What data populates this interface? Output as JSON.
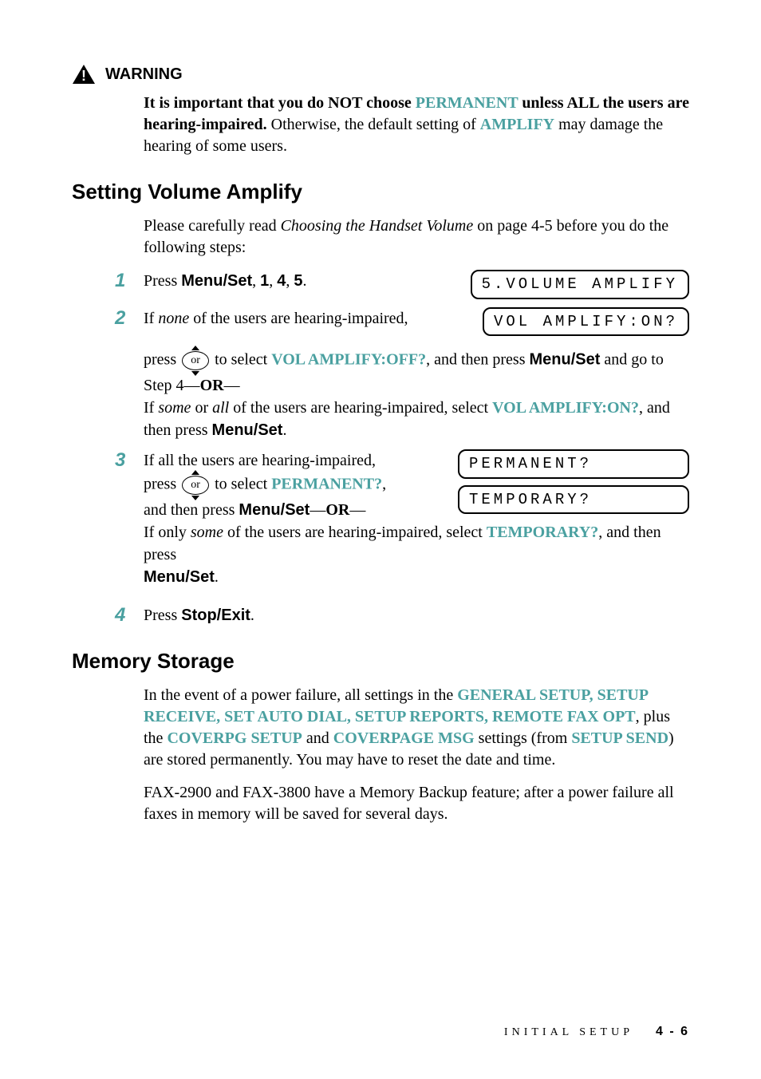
{
  "warning": {
    "label": "WARNING",
    "sentence_bold_lead": "It is important that you do NOT choose ",
    "permanent": "PERMANENT",
    "sentence_bold_tail": " unless ALL the users are hearing-impaired.",
    "sentence_rest_a": " Otherwise, the default setting of ",
    "amplify": "AMPLIFY",
    "sentence_rest_b": " may damage the hearing of some users."
  },
  "section1": {
    "title": "Setting Volume Amplify",
    "intro_a": "Please carefully read ",
    "intro_it": "Choosing the Handset Volume",
    "intro_b": " on page 4-5 before you do the following steps:"
  },
  "steps": {
    "s1": {
      "num": "1",
      "a": "Press ",
      "btn": "Menu/Set",
      "b": ", ",
      "k1": "1",
      "c": ", ",
      "k2": "4",
      "d": ", ",
      "k3": "5",
      "e": "."
    },
    "s2": {
      "num": "2",
      "line1_a": "If ",
      "line1_it": "none",
      "line1_b": " of the users are hearing-impaired,",
      "line2_a": " press ",
      "line2_b": " to select ",
      "teal1": "VOL AMPLIFY:OFF?",
      "line2_c": ", and then press ",
      "btn": "Menu/Set",
      "line2_d": " and go to Step 4—",
      "or": "OR",
      "line2_e": "—",
      "line3_a": "If ",
      "line3_it1": "some",
      "line3_b": " or ",
      "line3_it2": "all",
      "line3_c": " of the users are hearing-impaired, select ",
      "teal2": "VOL AMPLIFY:ON?",
      "line3_d": ", and then press ",
      "btn2": "Menu/Set",
      "line3_e": "."
    },
    "s3": {
      "num": "3",
      "l1": "If all the users are hearing-impaired,",
      "l2a": "press ",
      "l2b": " to select ",
      "teal1": "PERMANENT?",
      "l2c": ",",
      "l3a": "and then press ",
      "btn": "Menu/Set",
      "l3b": "—",
      "or": "OR",
      "l3c": "—",
      "l4a": "If only ",
      "l4it": "some",
      "l4b": " of the users are hearing-impaired, select ",
      "teal2": "TEMPORARY?",
      "l4c": ", and then press",
      "btn2": "Menu/Set",
      "l4d": "."
    },
    "s4": {
      "num": "4",
      "a": "Press ",
      "btn": "Stop/Exit",
      "b": "."
    }
  },
  "lcd": {
    "l1": "5.VOLUME AMPLIFY",
    "l2": "VOL AMPLIFY:ON?",
    "l3": "PERMANENT?",
    "l4": "TEMPORARY?"
  },
  "or_text": "or",
  "section2": {
    "title": "Memory Storage",
    "p1_a": "In the event of a power failure, all settings in the ",
    "t1": "GENERAL SETUP, SETUP RECEIVE, SET AUTO DIAL, SETUP REPORTS, REMOTE FAX OPT",
    "p1_b": ", plus the ",
    "t2": "COVERPG SETUP",
    "p1_c": " and ",
    "t3": "COVERPAGE MSG",
    "p1_d": " settings (from ",
    "t4": "SETUP SEND",
    "p1_e": ") are stored permanently. You may have to reset the date and time.",
    "p2": "FAX-2900 and FAX-3800 have a Memory Backup feature; after a power failure all faxes in memory will be saved for several days."
  },
  "footer": {
    "section": "INITIAL SETUP",
    "page": "4 - 6"
  }
}
